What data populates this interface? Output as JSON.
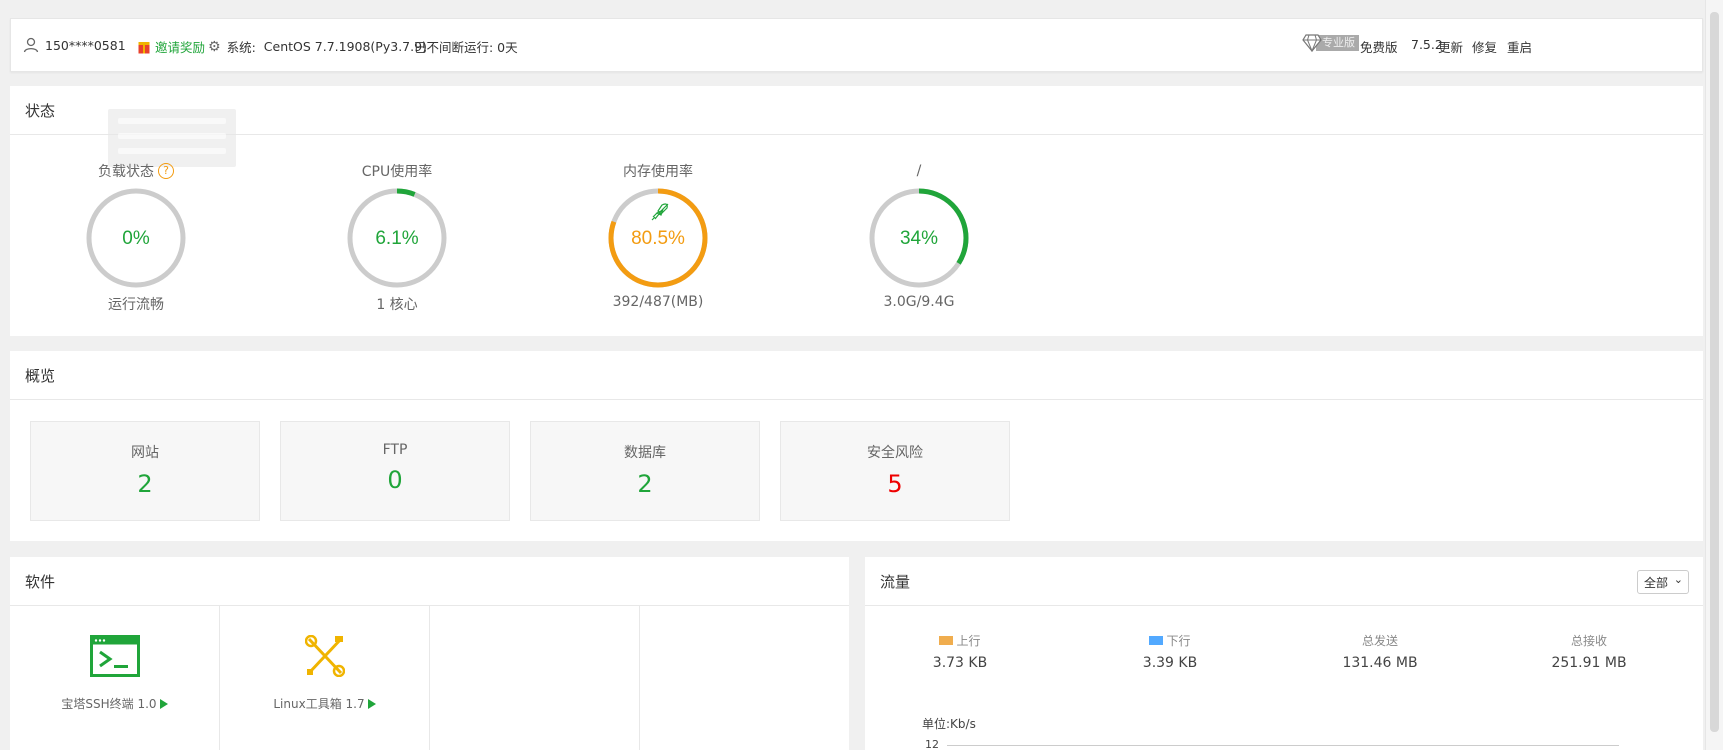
{
  "header": {
    "user": "150****0581",
    "invite": "邀请奖励",
    "system_label": "系统:",
    "system_value": "CentOS 7.7.1908(Py3.7.9)",
    "uptime": "已不间断运行: 0天",
    "pro_badge": "专业版",
    "edition": "免费版",
    "version": "7.5.2",
    "update": "更新",
    "repair": "修复",
    "restart": "重启"
  },
  "status": {
    "title": "状态",
    "gauges": [
      {
        "title": "负载状态",
        "value": "0%",
        "percent": 0,
        "sub": "运行流畅",
        "color": "#20a53a"
      },
      {
        "title": "CPU使用率",
        "value": "6.1%",
        "percent": 6.1,
        "sub": "1 核心",
        "color": "#20a53a"
      },
      {
        "title": "内存使用率",
        "value": "80.5%",
        "percent": 80.5,
        "sub": "392/487(MB)",
        "color": "#f39c12"
      },
      {
        "title": "/",
        "value": "34%",
        "percent": 34,
        "sub": "3.0G/9.4G",
        "color": "#20a53a"
      }
    ]
  },
  "overview": {
    "title": "概览",
    "items": [
      {
        "label": "网站",
        "value": "2"
      },
      {
        "label": "FTP",
        "value": "0"
      },
      {
        "label": "数据库",
        "value": "2"
      },
      {
        "label": "安全风险",
        "value": "5"
      }
    ]
  },
  "software": {
    "title": "软件",
    "items": [
      {
        "label": "宝塔SSH终端 1.0"
      },
      {
        "label": "Linux工具箱 1.7"
      }
    ]
  },
  "traffic": {
    "title": "流量",
    "select": "全部",
    "up_label": "上行",
    "up_value": "3.73 KB",
    "down_label": "下行",
    "down_value": "3.39 KB",
    "sent_label": "总发送",
    "sent_value": "131.46 MB",
    "recv_label": "总接收",
    "recv_value": "251.91 MB",
    "unit": "单位:Kb/s",
    "ytick": "12",
    "up_color": "#f0ad4e",
    "down_color": "#52a9ff"
  }
}
